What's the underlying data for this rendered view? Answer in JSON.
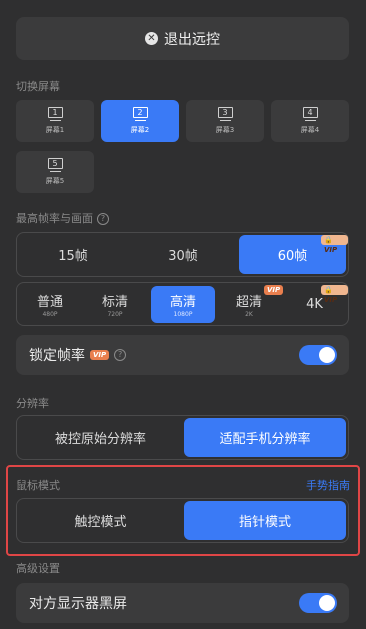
{
  "exit_button": {
    "label": "退出远控"
  },
  "switch_screen": {
    "title": "切换屏幕",
    "screens": [
      {
        "num": "1",
        "label": "屏幕1",
        "active": false
      },
      {
        "num": "2",
        "label": "屏幕2",
        "active": true
      },
      {
        "num": "3",
        "label": "屏幕3",
        "active": false
      },
      {
        "num": "4",
        "label": "屏幕4",
        "active": false
      },
      {
        "num": "5",
        "label": "屏幕5",
        "active": false
      }
    ]
  },
  "frame_quality": {
    "title": "最高帧率与画面",
    "help": "?",
    "fps_options": [
      {
        "label": "15帧",
        "active": false
      },
      {
        "label": "30帧",
        "active": false
      },
      {
        "label": "60帧",
        "active": true,
        "badge": "VIP"
      }
    ],
    "quality_options": [
      {
        "label": "普通",
        "sub": "480P",
        "active": false
      },
      {
        "label": "标清",
        "sub": "720P",
        "active": false
      },
      {
        "label": "高清",
        "sub": "1080P",
        "active": true
      },
      {
        "label": "超清",
        "sub": "2K",
        "active": false,
        "badge": "VIP"
      },
      {
        "label": "4K",
        "sub": "",
        "active": false,
        "badge": "VIP"
      }
    ],
    "lock_frame": {
      "label": "锁定帧率",
      "badge": "VIP",
      "help": "?",
      "enabled": true
    }
  },
  "resolution": {
    "title": "分辨率",
    "options": [
      {
        "label": "被控原始分辨率",
        "active": false
      },
      {
        "label": "适配手机分辨率",
        "active": true
      }
    ]
  },
  "mouse_mode": {
    "title": "鼠标模式",
    "link": "手势指南",
    "options": [
      {
        "label": "触控模式",
        "active": false
      },
      {
        "label": "指针模式",
        "active": true
      }
    ]
  },
  "advanced": {
    "title": "高级设置",
    "black_screen": {
      "label": "对方显示器黑屏",
      "enabled": true
    }
  },
  "colors": {
    "accent": "#3a7af6",
    "background": "#2f2f30",
    "card": "#3b3b3c",
    "vip": "#e97f4e",
    "highlight": "#e04646"
  }
}
